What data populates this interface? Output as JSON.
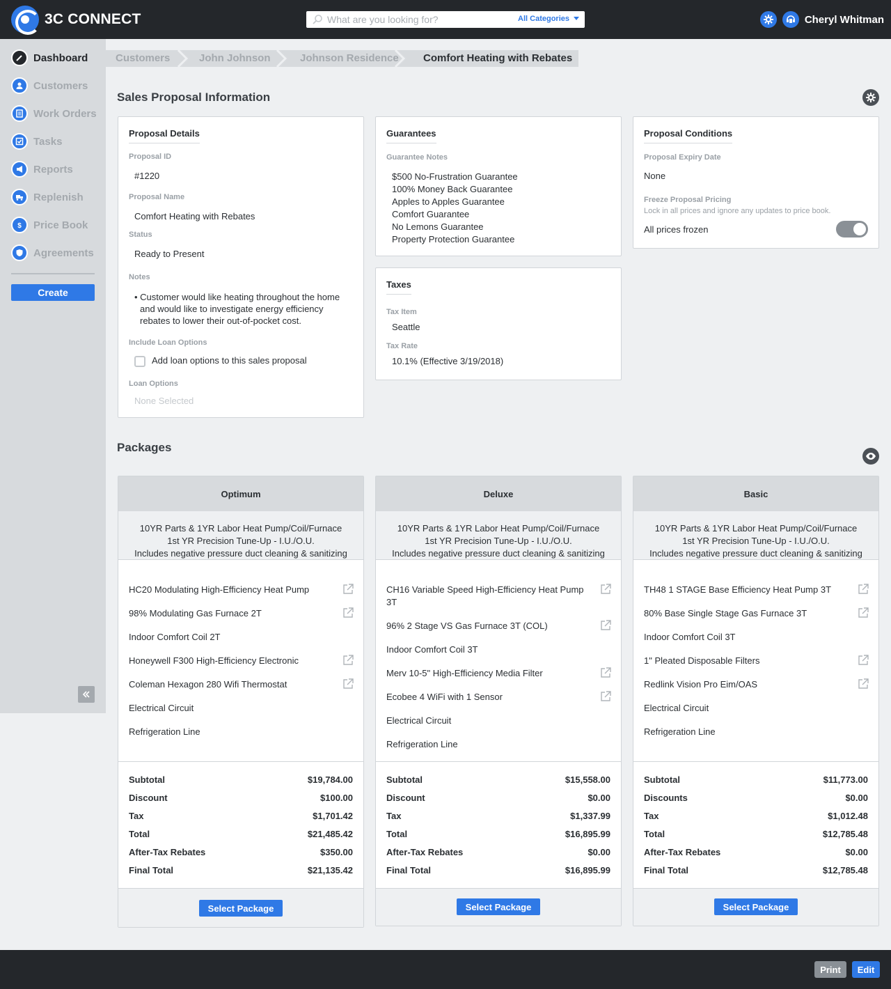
{
  "app": {
    "name": "3C CONNECT"
  },
  "search": {
    "placeholder": "What are you looking for?",
    "category": "All Categories"
  },
  "user": {
    "name": "Cheryl Whitman"
  },
  "sidebar": {
    "items": [
      {
        "label": "Dashboard",
        "icon": "gauge-icon",
        "active": true
      },
      {
        "label": "Customers",
        "icon": "customer-icon",
        "active": false
      },
      {
        "label": "Work Orders",
        "icon": "work-order-icon",
        "active": false
      },
      {
        "label": "Tasks",
        "icon": "task-check-icon",
        "active": false
      },
      {
        "label": "Reports",
        "icon": "megaphone-icon",
        "active": false
      },
      {
        "label": "Replenish",
        "icon": "truck-icon",
        "active": false
      },
      {
        "label": "Price Book",
        "icon": "dollar-icon",
        "active": false
      },
      {
        "label": "Agreements",
        "icon": "shield-icon",
        "active": false
      }
    ],
    "create_label": "Create"
  },
  "breadcrumb": [
    "Customers",
    "John Johnson",
    "Johnson Residence",
    "Comfort Heating with Rebates"
  ],
  "proposal_section": {
    "title": "Sales Proposal Information"
  },
  "proposal_details": {
    "title": "Proposal Details",
    "id_label": "Proposal ID",
    "id_value": "#1220",
    "name_label": "Proposal Name",
    "name_value": "Comfort Heating with Rebates",
    "status_label": "Status",
    "status_value": "Ready to Present",
    "notes_label": "Notes",
    "notes_line1": "• Customer would like heating throughout the home",
    "notes_line2": "and would like to investigate energy efficiency",
    "notes_line3": "rebates to lower their out-of-pocket cost.",
    "loan_label": "Include Loan Options",
    "loan_checkbox_label": "Add loan options to this sales proposal",
    "loan_options_label": "Loan Options",
    "loan_options_value": "None Selected"
  },
  "guarantees": {
    "title": "Guarantees",
    "notes_label": "Guarantee Notes",
    "items": [
      "$500 No-Frustration Guarantee",
      "100% Money Back Guarantee",
      "Apples to Apples Guarantee",
      "Comfort Guarantee",
      "No Lemons Guarantee",
      "Property Protection Guarantee"
    ]
  },
  "taxes": {
    "title": "Taxes",
    "item_label": "Tax Item",
    "item_value": "Seattle",
    "rate_label": "Tax Rate",
    "rate_value": "10.1% (Effective 3/19/2018)"
  },
  "conditions": {
    "title": "Proposal Conditions",
    "expiry_label": "Proposal Expiry Date",
    "expiry_value": "None",
    "freeze_label": "Freeze Proposal Pricing",
    "freeze_desc": "Lock in all prices and ignore any updates to price book.",
    "freeze_value": "All prices frozen",
    "frozen": true
  },
  "packages_section": {
    "title": "Packages"
  },
  "packages": [
    {
      "name": "Optimum",
      "desc1": "10YR Parts & 1YR Labor Heat Pump/Coil/Furnace",
      "desc2": "1st YR Precision Tune-Up - I.U./O.U.",
      "desc3": "Includes negative pressure duct cleaning & sanitizing",
      "items": [
        {
          "text": "HC20 Modulating High-Efficiency Heat Pump",
          "link": true
        },
        {
          "text": "98% Modulating Gas Furnace 2T",
          "link": true
        },
        {
          "text": "Indoor Comfort Coil 2T",
          "link": false
        },
        {
          "text": "Honeywell F300 High-Efficiency Electronic",
          "link": true
        },
        {
          "text": "Coleman Hexagon 280 Wifi Thermostat",
          "link": true
        },
        {
          "text": "Electrical Circuit",
          "link": false
        },
        {
          "text": "Refrigeration Line",
          "link": false
        }
      ],
      "totals": [
        {
          "label": "Subtotal",
          "value": "$19,784.00"
        },
        {
          "label": "Discount",
          "value": "$100.00"
        },
        {
          "label": "Tax",
          "value": "$1,701.42"
        },
        {
          "label": "Total",
          "value": "$21,485.42"
        },
        {
          "label": "After-Tax Rebates",
          "value": "$350.00"
        },
        {
          "label": "Final Total",
          "value": "$21,135.42"
        }
      ],
      "button": "Select Package"
    },
    {
      "name": "Deluxe",
      "desc1": "10YR Parts & 1YR Labor Heat Pump/Coil/Furnace",
      "desc2": "1st YR Precision Tune-Up - I.U./O.U.",
      "desc3": "Includes negative pressure duct cleaning & sanitizing",
      "items": [
        {
          "text": "CH16 Variable Speed High-Efficiency Heat Pump 3T",
          "link": true
        },
        {
          "text": "96% 2 Stage VS Gas Furnace 3T (COL)",
          "link": true
        },
        {
          "text": "Indoor Comfort Coil 3T",
          "link": false
        },
        {
          "text": "Merv 10-5\" High-Efficiency Media Filter",
          "link": true
        },
        {
          "text": "Ecobee 4 WiFi with 1 Sensor",
          "link": true
        },
        {
          "text": "Electrical Circuit",
          "link": false
        },
        {
          "text": "Refrigeration Line",
          "link": false
        }
      ],
      "totals": [
        {
          "label": "Subtotal",
          "value": "$15,558.00"
        },
        {
          "label": "Discount",
          "value": "$0.00"
        },
        {
          "label": "Tax",
          "value": "$1,337.99"
        },
        {
          "label": "Total",
          "value": "$16,895.99"
        },
        {
          "label": "After-Tax Rebates",
          "value": "$0.00"
        },
        {
          "label": "Final Total",
          "value": "$16,895.99"
        }
      ],
      "button": "Select Package"
    },
    {
      "name": "Basic",
      "desc1": "10YR Parts & 1YR Labor Heat Pump/Coil/Furnace",
      "desc2": "1st YR Precision Tune-Up - I.U./O.U.",
      "desc3": "Includes negative pressure duct cleaning & sanitizing",
      "items": [
        {
          "text": "TH48 1 STAGE Base Efficiency Heat Pump 3T",
          "link": true
        },
        {
          "text": "80% Base Single Stage Gas Furnace 3T",
          "link": true
        },
        {
          "text": "Indoor Comfort Coil 3T",
          "link": false
        },
        {
          "text": "1\" Pleated Disposable Filters",
          "link": true
        },
        {
          "text": "Redlink Vision Pro Eim/OAS",
          "link": true
        },
        {
          "text": "Electrical Circuit",
          "link": false
        },
        {
          "text": "Refrigeration Line",
          "link": false
        }
      ],
      "totals": [
        {
          "label": "Subtotal",
          "value": "$11,773.00"
        },
        {
          "label": "Discounts",
          "value": "$0.00"
        },
        {
          "label": "Tax",
          "value": "$1,012.48"
        },
        {
          "label": "Total",
          "value": "$12,785.48"
        },
        {
          "label": "After-Tax Rebates",
          "value": "$0.00"
        },
        {
          "label": "Final Total",
          "value": "$12,785.48"
        }
      ],
      "button": "Select Package"
    }
  ],
  "footer": {
    "print_label": "Print",
    "edit_label": "Edit"
  },
  "colors": {
    "accent": "#2f79e6",
    "dark": "#24272b",
    "panel": "#d7dadd"
  }
}
